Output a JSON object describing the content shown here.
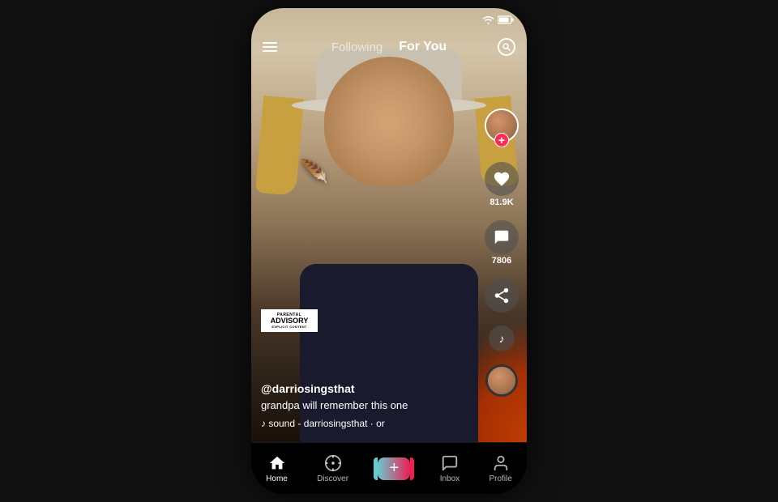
{
  "phone": {
    "status": {
      "time": "",
      "wifi": true,
      "battery": true
    },
    "top_nav": {
      "following_label": "Following",
      "foryou_label": "For You",
      "active_tab": "foryou"
    },
    "video": {
      "username": "@darriosingsthat",
      "caption": "grandpa will remember this one",
      "sound": "♪ sound - darriosingsthat · or",
      "likes": "81.9K",
      "comments": "7806"
    },
    "advisory": {
      "line1": "PARENTAL",
      "line2": "ADVISORY",
      "line3": "EXPLICIT CONTENT"
    },
    "bottom_nav": {
      "home_label": "Home",
      "discover_label": "Discover",
      "plus_label": "+",
      "inbox_label": "Inbox",
      "profile_label": "Profile"
    }
  }
}
